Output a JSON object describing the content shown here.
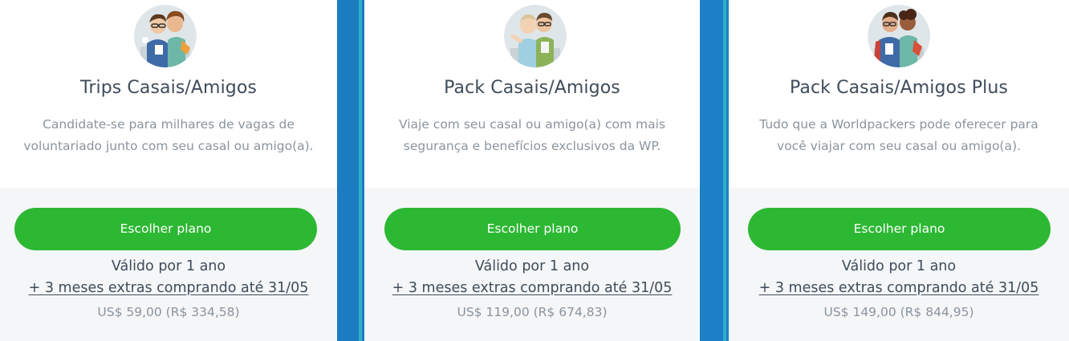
{
  "plans": [
    {
      "title": "Trips Casais/Amigos",
      "description_lines": [
        "Candidate-se para milhares de vagas de",
        "voluntariado junto com seu casal ou amigo(a)."
      ],
      "button_label": "Escolher plano",
      "validity": "Válido por 1 ano",
      "extra_offer": "+ 3 meses extras comprando até 31/05",
      "price": "US$ 59,00 (R$ 334,58)",
      "avatar_icon": "couple-illustration-icon"
    },
    {
      "title": "Pack Casais/Amigos",
      "description_lines": [
        "Viaje com seu casal ou amigo(a) com mais",
        "segurança e benefícios exclusivos da WP."
      ],
      "button_label": "Escolher plano",
      "validity": "Válido por 1 ano",
      "extra_offer": "+ 3 meses extras comprando até 31/05",
      "price": "US$ 119,00 (R$ 674,83)",
      "avatar_icon": "couple-illustration-icon"
    },
    {
      "title": "Pack Casais/Amigos Plus",
      "description_lines": [
        "Tudo que a Worldpackers pode oferecer para",
        "você viajar com seu casal ou amigo(a)."
      ],
      "button_label": "Escolher plano",
      "validity": "Válido por 1 ano",
      "extra_offer": "+ 3 meses extras comprando até 31/05",
      "price": "US$ 149,00 (R$ 844,95)",
      "avatar_icon": "couple-illustration-icon"
    }
  ],
  "colors": {
    "background_blue": "#1b7ec5",
    "accent_stripe": "#2eb0c7",
    "button_green": "#2db833",
    "title_text": "#3f4c5a",
    "muted_text": "#8a949d",
    "card_bottom_bg": "#f4f6f8"
  }
}
